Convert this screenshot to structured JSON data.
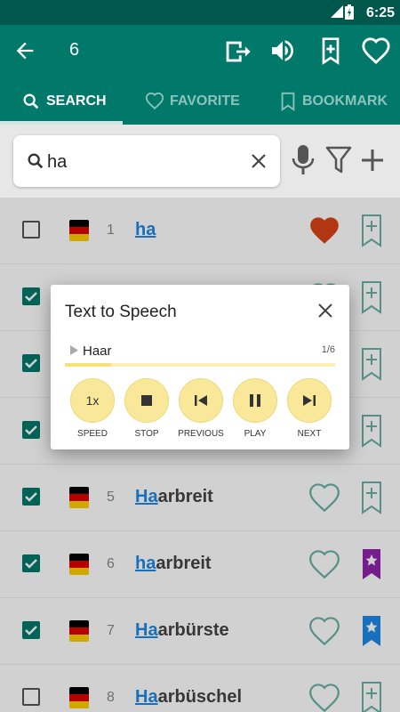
{
  "status_bar": {
    "time": "6:25"
  },
  "toolbar": {
    "count": "6"
  },
  "tabs": [
    {
      "label": "SEARCH",
      "icon": "search-icon"
    },
    {
      "label": "FAVORITE",
      "icon": "heart-outline-icon"
    },
    {
      "label": "BOOKMARK",
      "icon": "bookmark-outline-icon"
    }
  ],
  "search": {
    "value": "ha"
  },
  "rows": [
    {
      "num": "1",
      "hl": "ha",
      "rest": "",
      "checked": false,
      "favorite": true,
      "bookmark": "none"
    },
    {
      "num": "5",
      "hl": "Ha",
      "rest": "arbreit",
      "checked": true,
      "favorite": false,
      "bookmark": "none"
    },
    {
      "num": "6",
      "hl": "ha",
      "rest": "arbreit",
      "checked": true,
      "favorite": false,
      "bookmark": "purple"
    },
    {
      "num": "7",
      "hl": "Ha",
      "rest": "arbürste",
      "checked": true,
      "favorite": false,
      "bookmark": "blue"
    },
    {
      "num": "8",
      "hl": "Ha",
      "rest": "arbüschel",
      "checked": false,
      "favorite": false,
      "bookmark": "none"
    }
  ],
  "dialog": {
    "title": "Text to Speech",
    "current_word": "Haar",
    "progress_text": "1/6",
    "progress_fraction": 0.17,
    "controls": [
      {
        "label": "SPEED",
        "value": "1x"
      },
      {
        "label": "STOP"
      },
      {
        "label": "PREVIOUS"
      },
      {
        "label": "PLAY"
      },
      {
        "label": "NEXT"
      }
    ]
  },
  "colors": {
    "primary": "#00796b",
    "primary_dark": "#00574b",
    "link": "#1e88e5",
    "favorite_red": "#d84315",
    "bookmark_purple": "#8e24aa",
    "bookmark_blue": "#1e88e5",
    "control_yellow": "#fae89a"
  }
}
